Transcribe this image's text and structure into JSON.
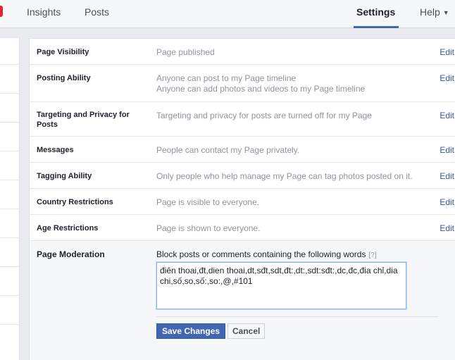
{
  "nav": {
    "insights": "Insights",
    "posts": "Posts",
    "settings": "Settings",
    "help": "Help"
  },
  "settings": {
    "edit_label": "Edit",
    "rows": [
      {
        "label": "Page Visibility",
        "value": "Page published"
      },
      {
        "label": "Posting Ability",
        "value": "Anyone can post to my Page timeline",
        "value2": "Anyone can add photos and videos to my Page timeline"
      },
      {
        "label": "Targeting and Privacy for Posts",
        "value": "Targeting and privacy for posts are turned off for my Page"
      },
      {
        "label": "Messages",
        "value": "People can contact my Page privately."
      },
      {
        "label": "Tagging Ability",
        "value": "Only people who help manage my Page can tag photos posted on it."
      },
      {
        "label": "Country Restrictions",
        "value": "Page is visible to everyone."
      },
      {
        "label": "Age Restrictions",
        "value": "Page is shown to everyone."
      }
    ],
    "moderation": {
      "label": "Page Moderation",
      "title": "Block posts or comments containing the following words",
      "help": "[?]",
      "words": "điên thoai,đt,dien thoai,dt,sđt,sdt,đt:,dt:,sdt:sđt:,dc,đc,đia chỉ,dia chi,số,so,số:,so:,@,#101",
      "save_label": "Save Changes",
      "cancel_label": "Cancel"
    }
  }
}
